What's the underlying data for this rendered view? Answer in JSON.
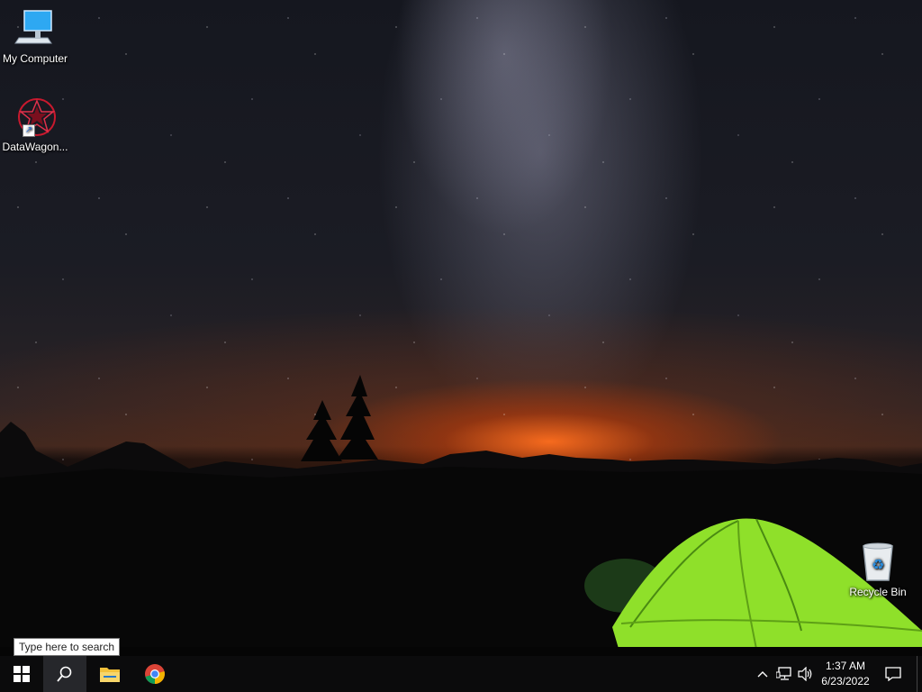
{
  "desktop": {
    "icons": [
      {
        "label": "My Computer",
        "icon": "computer-icon"
      },
      {
        "label": "DataWagon...",
        "icon": "datawagon-icon"
      },
      {
        "label": "Recycle Bin",
        "icon": "recycle-bin-icon"
      }
    ]
  },
  "search": {
    "placeholder": "Type here to search"
  },
  "taskbar": {
    "apps": [
      {
        "name": "start",
        "icon": "windows-logo-icon"
      },
      {
        "name": "search",
        "icon": "search-icon"
      },
      {
        "name": "file-explorer",
        "icon": "folder-icon"
      },
      {
        "name": "chrome",
        "icon": "chrome-icon"
      }
    ],
    "tray": {
      "icons": [
        "chevron-up-icon",
        "network-icon",
        "volume-icon",
        "notification-icon"
      ],
      "time": "1:37 AM",
      "date": "6/23/2022"
    }
  },
  "colors": {
    "taskbar": "#0b0b0c",
    "accent": "#2a6fd6",
    "tent": "#8fe02a"
  }
}
